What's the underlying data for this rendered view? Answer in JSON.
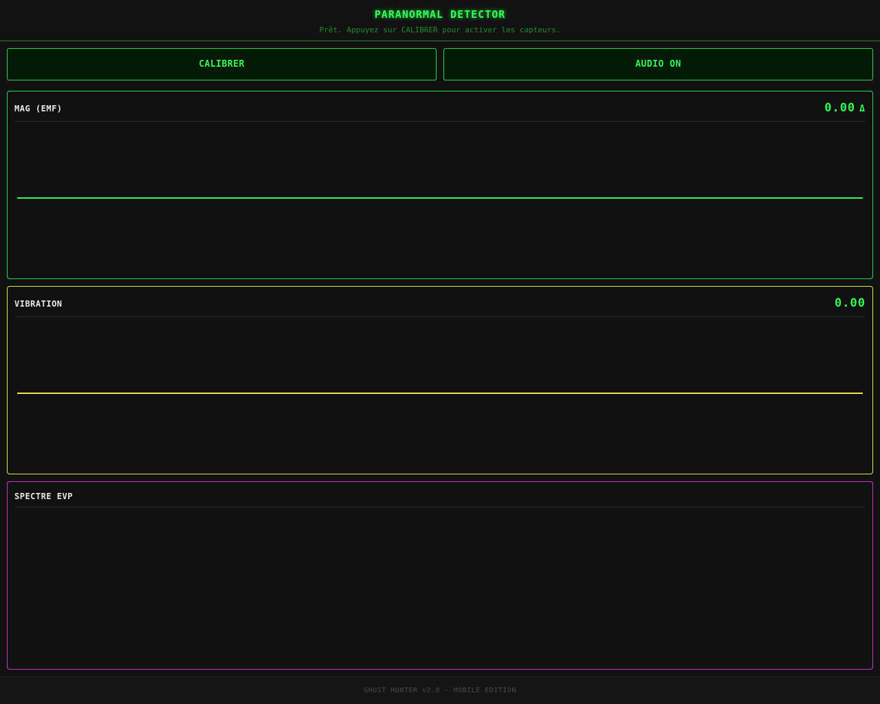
{
  "header": {
    "title": "PARANORMAL DETECTOR",
    "status": "Prêt. Appuyez sur CALIBRER pour activer les capteurs."
  },
  "controls": {
    "calibrate_label": "CALIBRER",
    "audio_label": "AUDIO ON"
  },
  "panels": {
    "emf": {
      "label": "MAG (EMF)",
      "value": "0.00",
      "delta_symbol": "Δ",
      "color": "#33ff55",
      "level": 0
    },
    "vibration": {
      "label": "VIBRATION",
      "value": "0.00",
      "color": "#e8e84a",
      "level": 0
    },
    "evp": {
      "label": "SPECTRE EVP",
      "color": "#d633c8"
    }
  },
  "footer": {
    "text": "GHOST HUNTER v2.0 - MOBILE EDITION"
  }
}
